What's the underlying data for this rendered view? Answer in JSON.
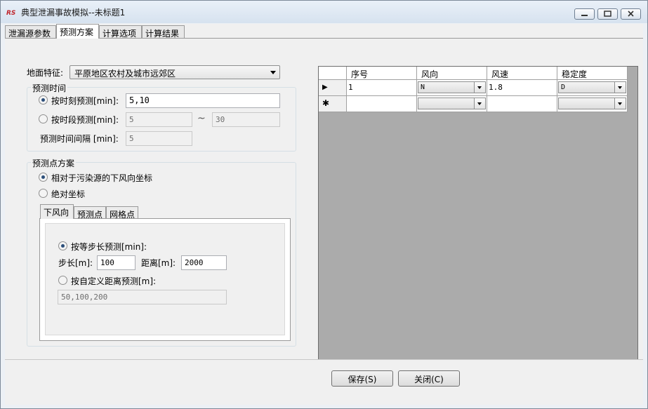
{
  "window": {
    "title": "典型泄漏事故模拟--未标题1"
  },
  "tabs": [
    "泄漏源参数",
    "预测方案",
    "计算选项",
    "计算结果"
  ],
  "surface": {
    "label": "地面特征:",
    "value": "平原地区农村及城市远郊区"
  },
  "time_group": {
    "title": "预测时间",
    "by_moment": {
      "label": "按时刻预测[min]:",
      "value": "5,10",
      "selected": true
    },
    "by_period": {
      "label": "按时段预测[min]:",
      "from": "5",
      "separator": "~",
      "to": "30",
      "selected": false
    },
    "interval": {
      "label": "预测时间间隔 [min]:",
      "value": "5"
    }
  },
  "point_group": {
    "title": "预测点方案",
    "relative": {
      "label": "相对于污染源的下风向坐标",
      "selected": true
    },
    "absolute": {
      "label": "绝对坐标",
      "selected": false
    },
    "subtabs": [
      "下风向",
      "预测点",
      "网格点"
    ],
    "equal_step": {
      "label": "按等步长预测[min]:",
      "selected": true
    },
    "step": {
      "label": "步长[m]:",
      "value": "100"
    },
    "distance": {
      "label": "距离[m]:",
      "value": "2000"
    },
    "custom": {
      "label": "按自定义距离预测[m]:",
      "selected": false,
      "value": "50,100,200"
    }
  },
  "grid": {
    "columns": [
      "序号",
      "风向",
      "风速",
      "稳定度"
    ],
    "rows": [
      {
        "marker": "▶",
        "index": "1",
        "direction": "N",
        "speed": "1.8",
        "stability": "D"
      },
      {
        "marker": "✱",
        "index": "",
        "direction": "",
        "speed": "",
        "stability": ""
      }
    ]
  },
  "buttons": {
    "save": "保存(S)",
    "close": "关闭(C)"
  },
  "colors": {
    "accent": "#2c4f7a",
    "grid_bg": "#ababab"
  }
}
